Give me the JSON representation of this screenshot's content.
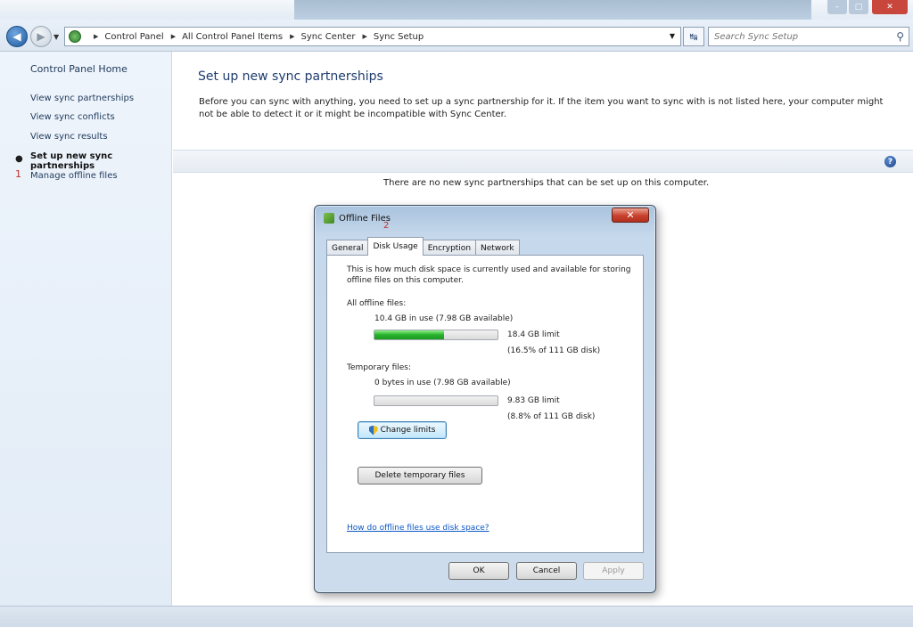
{
  "address_bar": {
    "breadcrumbs": [
      "Control Panel",
      "All Control Panel Items",
      "Sync Center",
      "Sync Setup"
    ],
    "search_placeholder": "Search Sync Setup"
  },
  "sidebar": {
    "home": "Control Panel Home",
    "items": [
      {
        "label": "View sync partnerships"
      },
      {
        "label": "View sync conflicts"
      },
      {
        "label": "View sync results"
      },
      {
        "label": "Set up new sync partnerships",
        "current": true
      },
      {
        "label": "Manage offline files"
      }
    ],
    "annotation": "1"
  },
  "main": {
    "title": "Set up new sync partnerships",
    "description": "Before you can sync with anything, you need to set up a sync partnership for it. If the item you want to sync with is not listed here, your computer might not be able to detect it or it might be incompatible with Sync Center.",
    "empty_message": "There are no new sync partnerships that can be set up on this computer."
  },
  "dialog": {
    "title": "Offline Files",
    "annotation": "2",
    "tabs": [
      {
        "label": "General"
      },
      {
        "label": "Disk Usage",
        "active": true
      },
      {
        "label": "Encryption"
      },
      {
        "label": "Network"
      }
    ],
    "intro": "This is how much disk space is currently used and available for storing offline files on this computer.",
    "all_offline": {
      "heading": "All offline files:",
      "usage": "10.4 GB in use (7.98 GB available)",
      "limit": "18.4 GB limit",
      "percent": "(16.5% of 111 GB disk)",
      "fill_fraction": 0.565
    },
    "temporary": {
      "heading": "Temporary files:",
      "usage": "0 bytes in use (7.98 GB available)",
      "limit": "9.83 GB limit",
      "percent": "(8.8% of 111 GB disk)",
      "fill_fraction": 0
    },
    "change_limits": "Change limits",
    "delete_temp": "Delete temporary files",
    "help_link": "How do offline files use disk space?",
    "ok": "OK",
    "cancel": "Cancel",
    "apply": "Apply"
  },
  "colors": {
    "accent": "#1e3c6e",
    "link": "#0b58c4",
    "usage_bar": "#27b22b",
    "annotation": "#c0302a"
  }
}
